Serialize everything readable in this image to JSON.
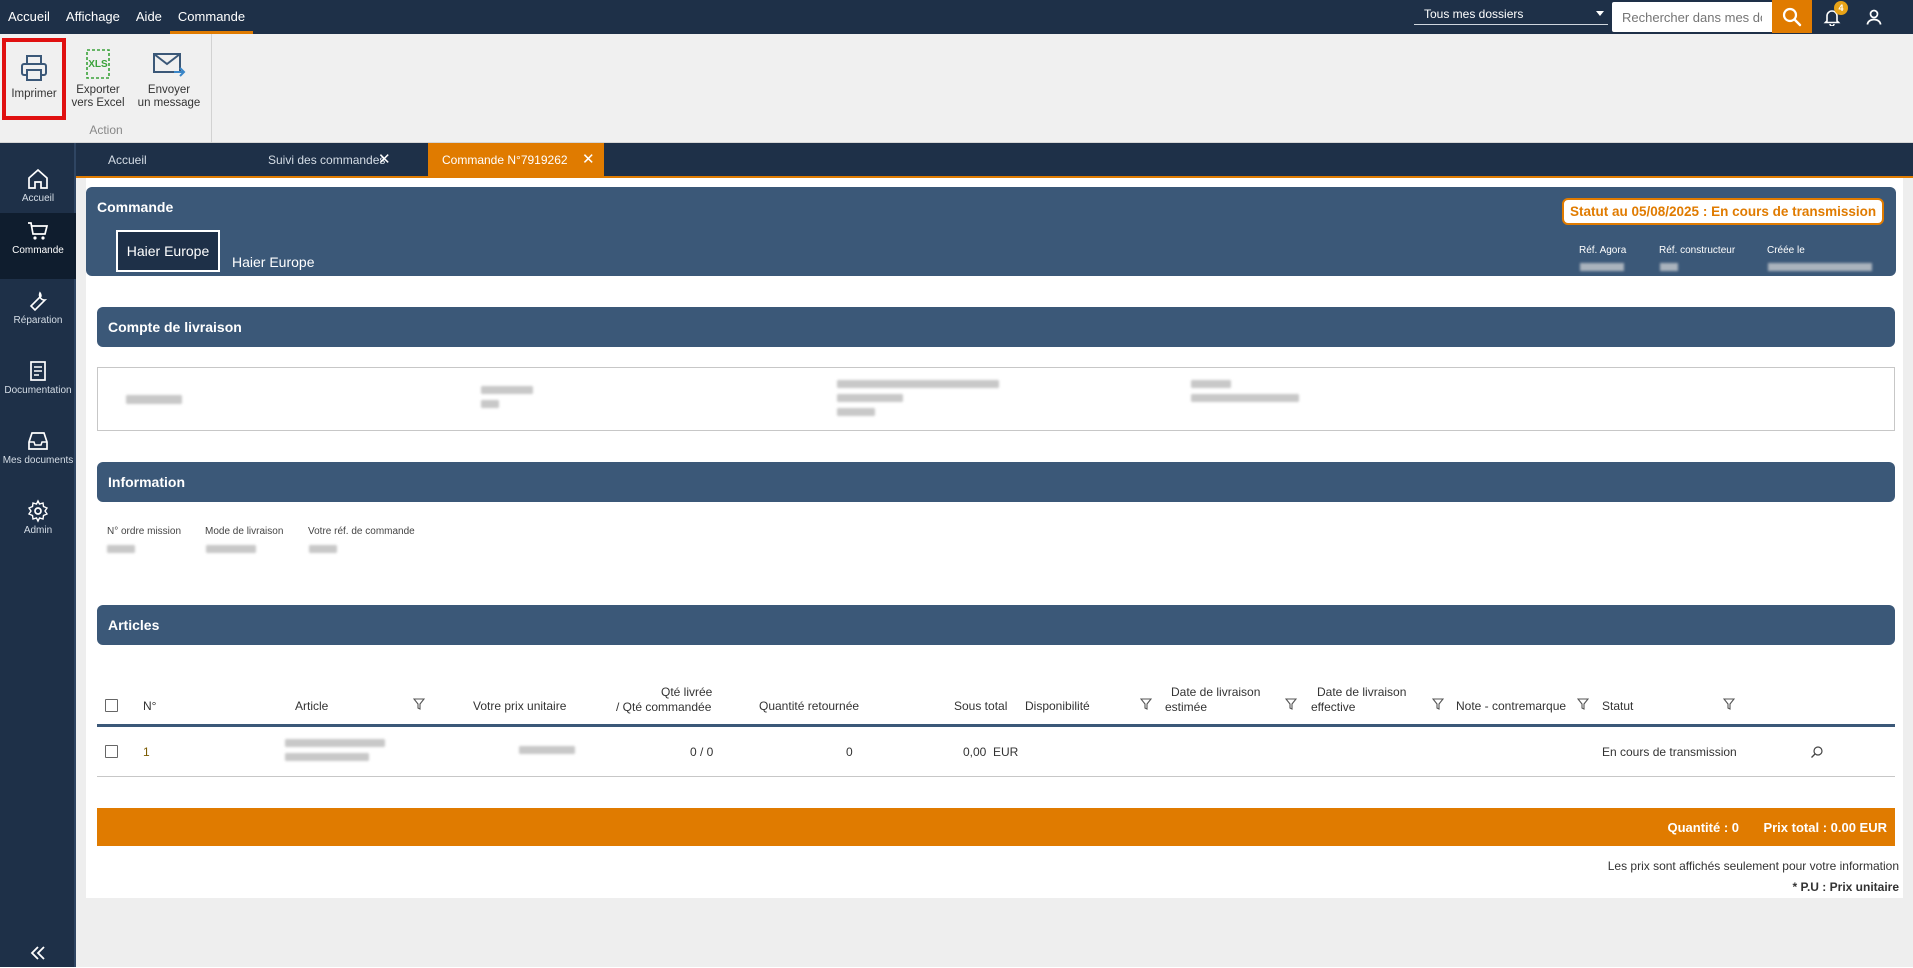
{
  "menu": {
    "items": [
      "Accueil",
      "Affichage",
      "Aide",
      "Commande"
    ],
    "active": "Commande"
  },
  "search": {
    "folder_selected": "Tous mes dossiers",
    "placeholder": "Rechercher dans mes dossiers"
  },
  "notifications": {
    "count": "4"
  },
  "ribbon": {
    "print_label": "Imprimer",
    "excel_label_1": "Exporter",
    "excel_label_2": "vers Excel",
    "excel_icon_text": "XLS",
    "mail_label_1": "Envoyer",
    "mail_label_2": "un message",
    "group_label": "Action"
  },
  "sidebar": {
    "items": [
      {
        "label": "Accueil",
        "icon": "home-icon"
      },
      {
        "label": "Commande",
        "icon": "cart-icon"
      },
      {
        "label": "Réparation",
        "icon": "wrench-icon"
      },
      {
        "label": "Documentation",
        "icon": "document-icon"
      },
      {
        "label": "Mes documents",
        "icon": "inbox-icon"
      },
      {
        "label": "Admin",
        "icon": "gear-icon"
      }
    ],
    "active": "Commande"
  },
  "tabs": [
    {
      "label": "Accueil",
      "closable": false
    },
    {
      "label": "Suivi des commandes",
      "closable": true
    },
    {
      "label": "Commande N°7919262",
      "closable": true,
      "active": true
    }
  ],
  "order": {
    "title": "Commande",
    "brand_logo_text": "Haier Europe",
    "brand_name": "Haier Europe",
    "status_prefix": "Statut au 05/08/2025 : ",
    "status_value": "En cours de transmission",
    "ref_agora_label": "Réf. Agora",
    "ref_constructeur_label": "Réf. constructeur",
    "created_label": "Créée le"
  },
  "delivery": {
    "title": "Compte de livraison"
  },
  "information": {
    "title": "Information",
    "ordre_mission_label": "N° ordre mission",
    "mode_livraison_label": "Mode de livraison",
    "votre_ref_label": "Votre réf. de commande"
  },
  "articles": {
    "title": "Articles",
    "headers": {
      "num": "N°",
      "article": "Article",
      "prix": "Votre prix unitaire",
      "qte_1": "Qté livrée",
      "qte_2": "/ Qté commandée",
      "qte_ret": "Quantité retournée",
      "sous_total": "Sous total",
      "dispo": "Disponibilité",
      "date_est_1": "Date de livraison",
      "date_est_2": "estimée",
      "date_eff_1": "Date de livraison",
      "date_eff_2": "effective",
      "note": "Note - contremarque",
      "statut": "Statut"
    },
    "rows": [
      {
        "num": "1",
        "qte": "0 /  0",
        "qte_ret": "0",
        "sous_total": "0,00",
        "devise": "EUR",
        "statut": "En cours de transmission"
      }
    ]
  },
  "totals": {
    "quantite": "Quantité : 0",
    "prix_total": "Prix total : 0.00  EUR",
    "note": "Les prix sont affichés seulement pour votre information",
    "legend": "* P.U : Prix unitaire"
  },
  "colors": {
    "navy": "#1e3048",
    "panel_blue": "#3b5878",
    "accent": "#e07b00"
  }
}
